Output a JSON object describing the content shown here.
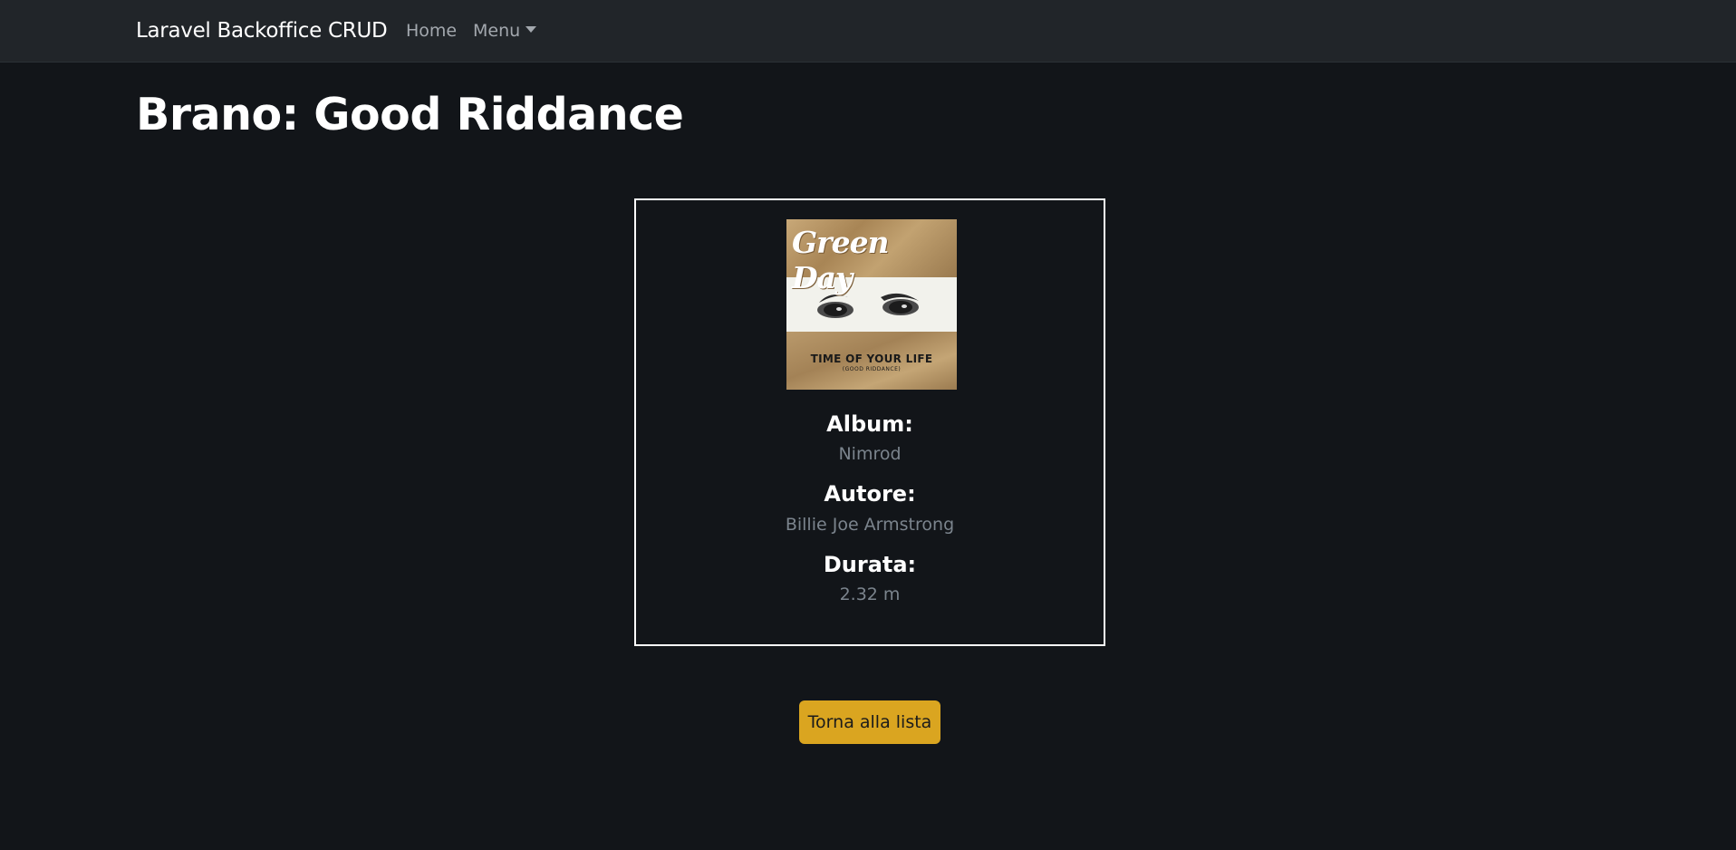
{
  "navbar": {
    "brand": "Laravel Backoffice CRUD",
    "home_label": "Home",
    "menu_label": "Menu"
  },
  "page": {
    "title": "Brano: Good Riddance"
  },
  "card": {
    "cover": {
      "band_name": "Green Day",
      "single_title": "TIME OF YOUR LIFE",
      "single_subtitle": "(GOOD RIDDANCE)"
    },
    "album_label": "Album:",
    "album_value": "Nimrod",
    "author_label": "Autore:",
    "author_value": "Billie Joe Armstrong",
    "duration_label": "Durata:",
    "duration_value": "2.32 m"
  },
  "actions": {
    "back_label": "Torna alla lista"
  },
  "colors": {
    "background": "#121519",
    "navbar": "#212529",
    "button": "#daa520",
    "muted_text": "#7b848d"
  }
}
